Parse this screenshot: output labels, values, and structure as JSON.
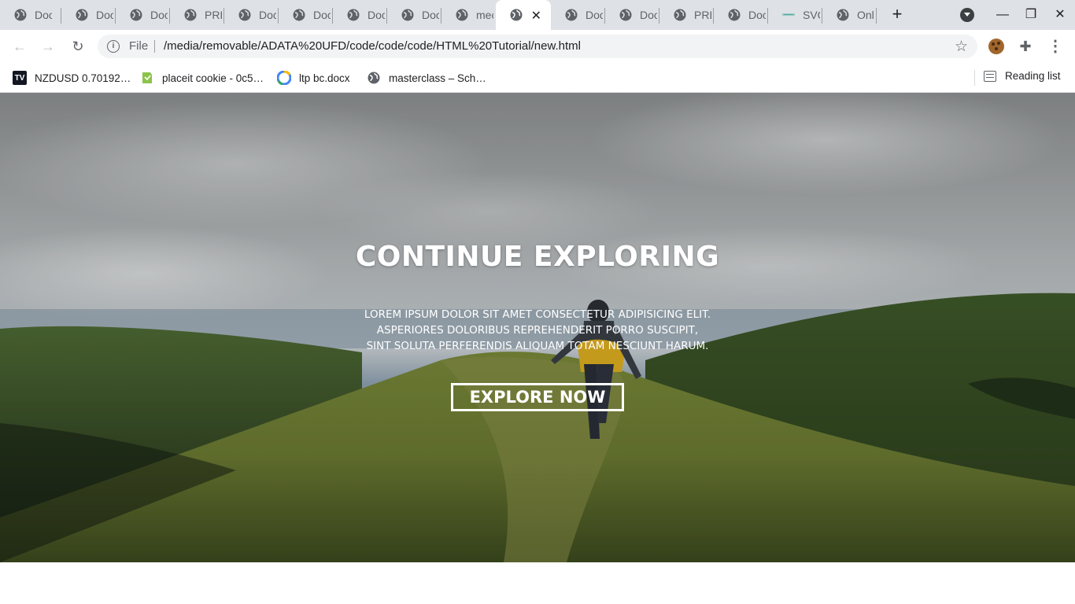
{
  "tabs": [
    {
      "title": "Doc"
    },
    {
      "title": "Doc"
    },
    {
      "title": "Doc"
    },
    {
      "title": "PRE"
    },
    {
      "title": "Doc"
    },
    {
      "title": "Doc"
    },
    {
      "title": "Doc"
    },
    {
      "title": "Doc"
    },
    {
      "title": "mec"
    },
    {
      "title": "",
      "active": true
    },
    {
      "title": "Doc"
    },
    {
      "title": "Doc"
    },
    {
      "title": "PRE"
    },
    {
      "title": "Doc"
    },
    {
      "title": "SVC"
    },
    {
      "title": "Onl"
    }
  ],
  "toolbar": {
    "file_label": "File",
    "url": "/media/removable/ADATA%20UFD/code/code/code/HTML%20Tutorial/new.html"
  },
  "bookmarks": [
    {
      "label": "NZDUSD 0.70192…",
      "icon": "tradingview-icon"
    },
    {
      "label": "placeit cookie - 0c5…",
      "icon": "placeit-icon"
    },
    {
      "label": "ltp bc.docx",
      "icon": "drive-icon"
    },
    {
      "label": "masterclass – Sch…",
      "icon": "globe-icon"
    }
  ],
  "reading_list": "Reading list",
  "hero": {
    "title": "CONTINUE EXPLORING",
    "text_lines": [
      "LOREM IPSUM DOLOR SIT AMET CONSECTETUR ADIPISICING ELIT.",
      "ASPERIORES DOLORIBUS REPREHENDERIT PORRO SUSCIPIT,",
      "SINT SOLUTA PERFERENDIS ALIQUAM TOTAM NESCIUNT HARUM."
    ],
    "button": "EXPLORE NOW"
  },
  "colors": {
    "tabstrip": "#dee1e6",
    "omnibox": "#f1f3f4",
    "hero_text": "#ffffff"
  }
}
